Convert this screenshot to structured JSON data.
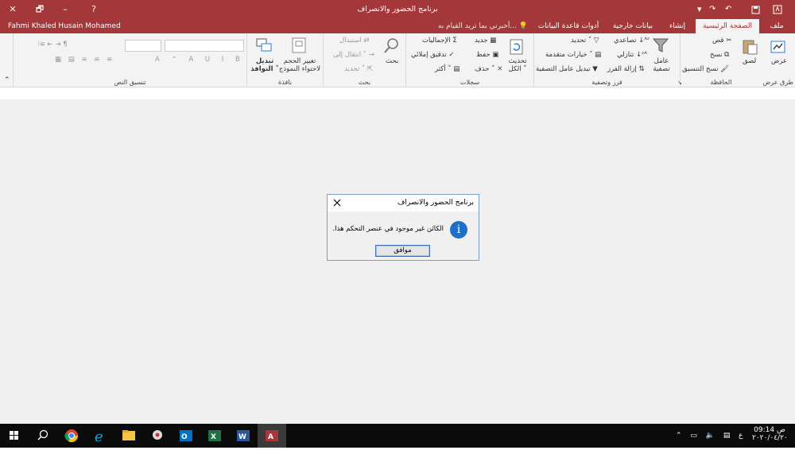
{
  "window": {
    "title": "برنامج الحضور والانصراف",
    "user": "Fahmi Khaled Husain Mohamed",
    "controls": {
      "close": "✕",
      "restore": "🗗",
      "minimize": "–",
      "help": "?"
    }
  },
  "tabs": [
    {
      "label": "ملف"
    },
    {
      "label": "الصفحة الرئيسية",
      "active": true
    },
    {
      "label": "إنشاء"
    },
    {
      "label": "بيانات خارجية"
    },
    {
      "label": "أدوات قاعدة البيانات"
    },
    {
      "label": "أخبرني بما تريد القيام به..."
    }
  ],
  "ribbon": {
    "views": {
      "view": "عرض",
      "group": "طرق عرض"
    },
    "clipboard": {
      "paste": "لصق",
      "cut": "قص",
      "copy": "نسخ",
      "format_painter": "نسخ التنسيق",
      "group": "الحافظة"
    },
    "sort_filter": {
      "filter": "عامل تصفية",
      "ascending": "تصاعدي",
      "descending": "تنازلي",
      "remove_sort": "إزالة الفرز",
      "selection": "تحديد ˅",
      "advanced": "خيارات متقدمة ˅",
      "toggle_filter": "تبديل عامل التصفية",
      "group": "فرز وتصفية"
    },
    "records": {
      "refresh": "تحديث الكل ˅",
      "new": "جديد",
      "save": "حفظ",
      "delete": "حذف ˅",
      "totals": "الإجماليات",
      "spelling": "تدقيق إملائي",
      "more": "أكثر ˅",
      "group": "سجلات"
    },
    "find": {
      "find": "بحث",
      "replace": "استبدال",
      "goto": "انتقال إلى ˅",
      "select": "تحديد ˅",
      "group": "بحث"
    },
    "window": {
      "size_to_fit": "تغيير الحجم لاحتواء النموذج",
      "switch_windows": "تبديل النوافذ ˅",
      "group": "نافذة"
    },
    "text_formatting": {
      "group": "تنسيق النص"
    }
  },
  "dialog": {
    "title": "برنامج الحضور والانصراف",
    "message": "الكائن غير موجود في عنصر التحكم هذا.",
    "ok": "موافق",
    "info_glyph": "i"
  },
  "taskbar": {
    "time": "09:14 ص",
    "date": "٢٠٢٠/٠٤/٢٠",
    "lang": "ع"
  },
  "colors": {
    "accent": "#a4373a",
    "ribbon": "#f3f3f3",
    "taskbar": "#0b0b0b",
    "dialog_border": "#7a9cc8"
  }
}
